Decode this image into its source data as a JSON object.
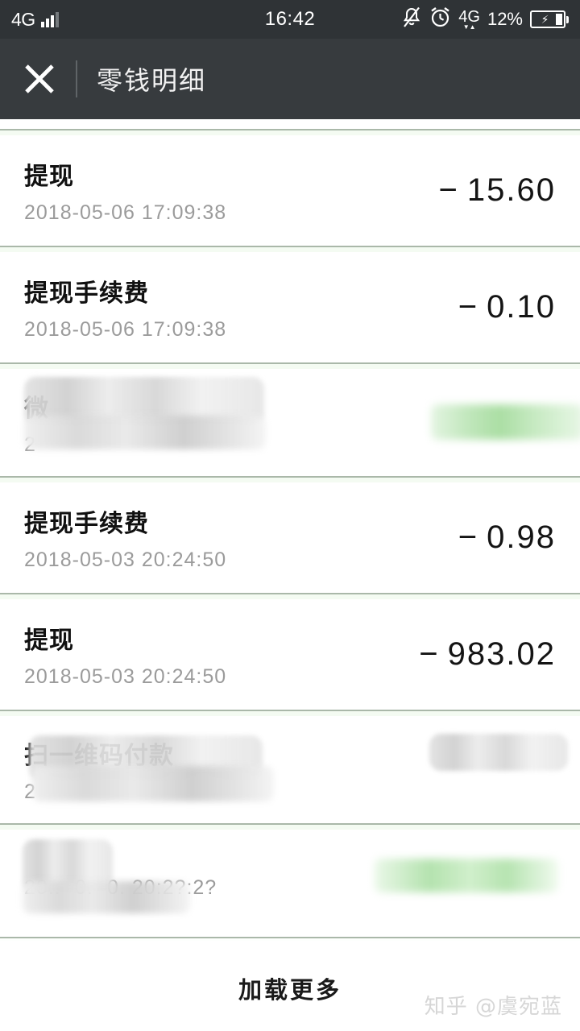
{
  "status_bar": {
    "network_left": "4G",
    "signal_icon": "signal-bars-icon",
    "time": "16:42",
    "mute_icon": "bell-muted-icon",
    "alarm_icon": "alarm-clock-icon",
    "data_network": "4G",
    "data_arrows": "▼▲",
    "battery_percent": "12%",
    "battery_icon": "battery-charging-icon",
    "background_color": "#2f3336"
  },
  "header": {
    "close_icon": "close-icon",
    "title": "零钱明细",
    "background_color": "#373b3e"
  },
  "list": {
    "divider_color": "#aab8a9",
    "rows": [
      {
        "title": "提现",
        "date": "2018-05-06 17:09:38",
        "amount": "15.60",
        "sign": "−",
        "redacted": false,
        "amount_color": "#141414"
      },
      {
        "title": "提现手续费",
        "date": "2018-05-06 17:09:38",
        "amount": "0.10",
        "sign": "−",
        "redacted": false,
        "amount_color": "#141414"
      },
      {
        "title": "微",
        "date": "2",
        "amount": "",
        "sign": "",
        "redacted": true,
        "redaction_style": "grey-mosaic",
        "amount_redaction_style": "green-mosaic",
        "amount_color": "#8fd489"
      },
      {
        "title": "提现手续费",
        "date": "2018-05-03 20:24:50",
        "amount": "0.98",
        "sign": "−",
        "redacted": false,
        "amount_color": "#141414"
      },
      {
        "title": "提现",
        "date": "2018-05-03 20:24:50",
        "amount": "983.02",
        "sign": "−",
        "redacted": false,
        "amount_color": "#141414"
      },
      {
        "title": "扫一维码付款",
        "date": "2",
        "amount": "",
        "sign": "",
        "redacted": true,
        "redaction_style": "grey-mosaic",
        "amount_redaction_style": "grey-mosaic",
        "amount_color": "#cccccc"
      },
      {
        "title": "",
        "date": "20.. -0. -0. 20:2?:2?",
        "amount": "",
        "sign": "",
        "redacted": true,
        "redaction_style": "grey-mosaic",
        "amount_redaction_style": "green-mosaic",
        "amount_color": "#8fd489"
      }
    ]
  },
  "footer": {
    "load_more": "加载更多",
    "watermark": "知乎 @虞宛蓝"
  }
}
